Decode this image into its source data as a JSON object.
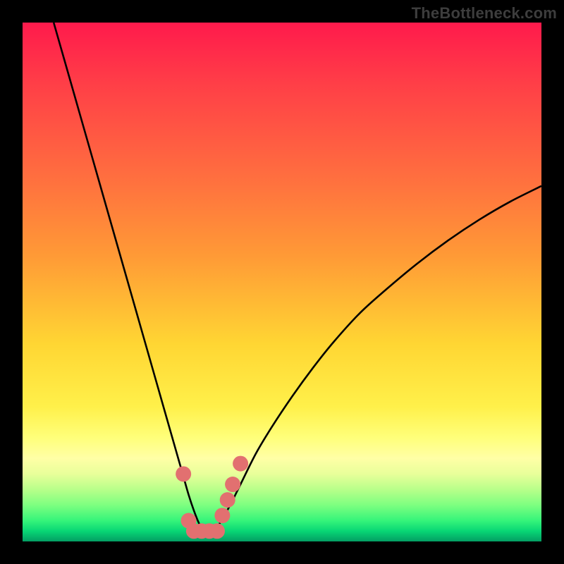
{
  "watermark": "TheBottleneck.com",
  "colors": {
    "frame": "#000000",
    "watermark": "#3d3d3d",
    "curve_stroke": "#000000",
    "dot_fill": "#e27070"
  },
  "chart_data": {
    "type": "line",
    "title": "",
    "xlabel": "",
    "ylabel": "",
    "xlim": [
      0,
      100
    ],
    "ylim": [
      0,
      100
    ],
    "grid": false,
    "series": [
      {
        "name": "bottleneck-curve",
        "x": [
          6,
          8,
          10,
          12,
          14,
          16,
          18,
          20,
          22,
          24,
          26,
          28,
          30,
          31,
          32,
          33,
          34,
          35,
          36,
          37,
          38,
          40,
          42,
          45,
          48,
          52,
          56,
          60,
          65,
          70,
          76,
          82,
          88,
          94,
          100
        ],
        "y": [
          100,
          93,
          86,
          79,
          72,
          65,
          58,
          51,
          44,
          37,
          30,
          23,
          16,
          12.5,
          9,
          6,
          3.5,
          2,
          1.5,
          2,
          3.5,
          7,
          11,
          17,
          22,
          28,
          33.5,
          38.5,
          44,
          48.5,
          53.5,
          58,
          62,
          65.5,
          68.5
        ]
      }
    ],
    "markers": [
      {
        "name": "dot-left-upper",
        "x": 31.0,
        "y": 13.0
      },
      {
        "name": "dot-left-lower",
        "x": 32.0,
        "y": 4.0
      },
      {
        "name": "dot-bottom-1",
        "x": 33.0,
        "y": 2.0
      },
      {
        "name": "dot-bottom-2",
        "x": 34.5,
        "y": 2.0
      },
      {
        "name": "dot-bottom-3",
        "x": 36.0,
        "y": 2.0
      },
      {
        "name": "dot-bottom-4",
        "x": 37.5,
        "y": 2.0
      },
      {
        "name": "dot-right-1",
        "x": 38.5,
        "y": 5.0
      },
      {
        "name": "dot-right-2",
        "x": 39.5,
        "y": 8.0
      },
      {
        "name": "dot-right-3",
        "x": 40.5,
        "y": 11.0
      },
      {
        "name": "dot-right-upper",
        "x": 42.0,
        "y": 15.0
      }
    ]
  }
}
